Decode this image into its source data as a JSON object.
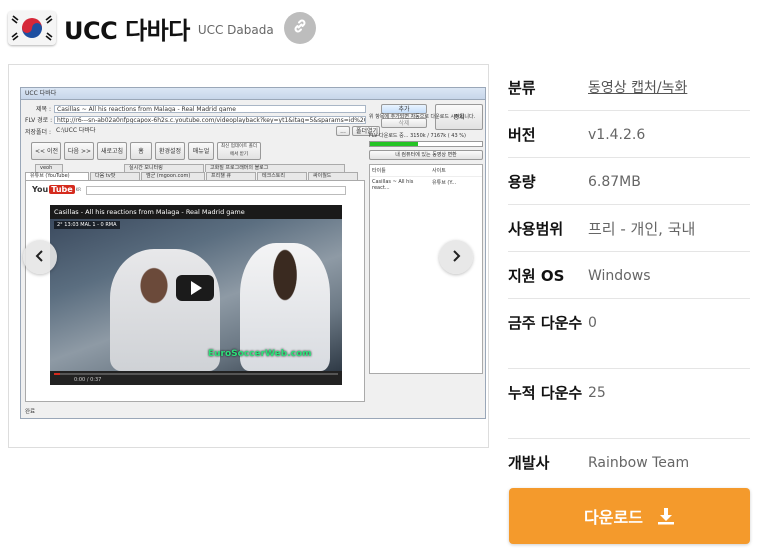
{
  "header": {
    "title": "UCC 다바다",
    "subtitle": "UCC Dabada",
    "flag_icon": "south-korea-flag-icon",
    "link_icon": "link-icon"
  },
  "screenshot": {
    "window_title": "UCC 다바다",
    "title_label": "제목 :",
    "title_value": "Casillas ~ All his reactions from Malaga - Real Madrid game",
    "flv_label": "FLV 경로 :",
    "flv_value": "http://r6---sn-ab02a0nfpgcapox-6h2s.c.youtube.com/videoplayback?key=yt1&itag=5&sparams=id%2Cip%2Cipbits%2Citag%2Cratebypass",
    "save_label": "저장폴더 :",
    "save_value": "C:\\UCC 다바다",
    "btn_add": "추가",
    "btn_delete": "삭제",
    "btn_stop": "중지",
    "btn_browse": "...",
    "btn_open_folder": "폴더열기",
    "nav_buttons": [
      "<< 이전",
      "다음 >>",
      "새로고침",
      "홈",
      "환경설정",
      "매뉴얼",
      "최신 업데이트 폴더에서 받기"
    ],
    "tabs_top": [
      "veoh",
      "실시간 모니터링",
      "고화질 프로그래머의 블로그"
    ],
    "tabs_bottom": [
      "유튜브 (YouTube)",
      "다음 tv팟",
      "엠군 (mgoon.com)",
      "프리챌 큐",
      "테크스토리",
      "싸이월드"
    ],
    "yt_logo_you": "You",
    "yt_logo_tube": "Tube",
    "yt_logo_kr": "KR",
    "video_title": "Casillas - All his reactions from Malaga - Real Madrid game",
    "scoreboard": "2° 13:03  MAL 1 - 0 RMA",
    "watermark": "EuroSoccerWeb.com",
    "time": "0:00 / 0:37",
    "status": "완료",
    "right_info": "위 항목에 추가되면 자동으로 다운로드 시작됩니다.",
    "progress_text": "FLV 다운로드 중... 3150k / 7167k ( 43 %)",
    "progress_value": 0.43,
    "convert_btn": "내 컴퓨터에 있는 동영상 변환",
    "list_col1": "타이틀",
    "list_col2": "사이트",
    "list_item_title": "Casillas ~ All his react...",
    "list_item_site": "유튜브 (Y..."
  },
  "info": {
    "rows": [
      {
        "key": "분류",
        "value": "동영상 캡처/녹화"
      },
      {
        "key": "버전",
        "value": "v1.4.2.6"
      },
      {
        "key": "용량",
        "value": "6.87MB"
      },
      {
        "key": "사용범위",
        "value": "프리 - 개인, 국내"
      },
      {
        "key": "지원 OS",
        "value": "Windows"
      },
      {
        "key": "금주 다운수",
        "value": "0"
      },
      {
        "key": "누적 다운수",
        "value": "25"
      },
      {
        "key": "개발사",
        "value": "Rainbow Team"
      }
    ]
  },
  "download": {
    "label": "다운로드",
    "icon": "download-icon"
  }
}
